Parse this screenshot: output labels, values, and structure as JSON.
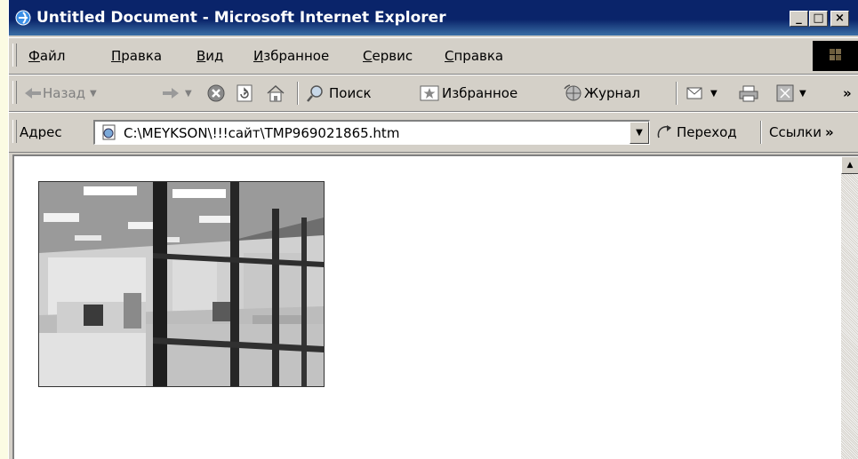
{
  "window": {
    "title": "Untitled Document - Microsoft Internet Explorer",
    "caption_buttons": [
      "_",
      "□",
      "×"
    ]
  },
  "menu": {
    "items": [
      "Файл",
      "Правка",
      "Вид",
      "Избранное",
      "Сервис",
      "Справка"
    ]
  },
  "toolbar": {
    "back_label": "Назад",
    "search_label": "Поиск",
    "favorites_label": "Избранное",
    "history_label": "Журнал",
    "more": "»"
  },
  "address": {
    "label": "Адрес",
    "value": "C:\\MEYKSON\\!!!сайт\\TMP969021865.htm",
    "go_label": "Переход",
    "links_label": "Ссылки",
    "more": "»"
  },
  "colors": {
    "titlebar": "#0a246a",
    "chrome": "#d4d0c8",
    "page_background": "#fbfbe3"
  }
}
